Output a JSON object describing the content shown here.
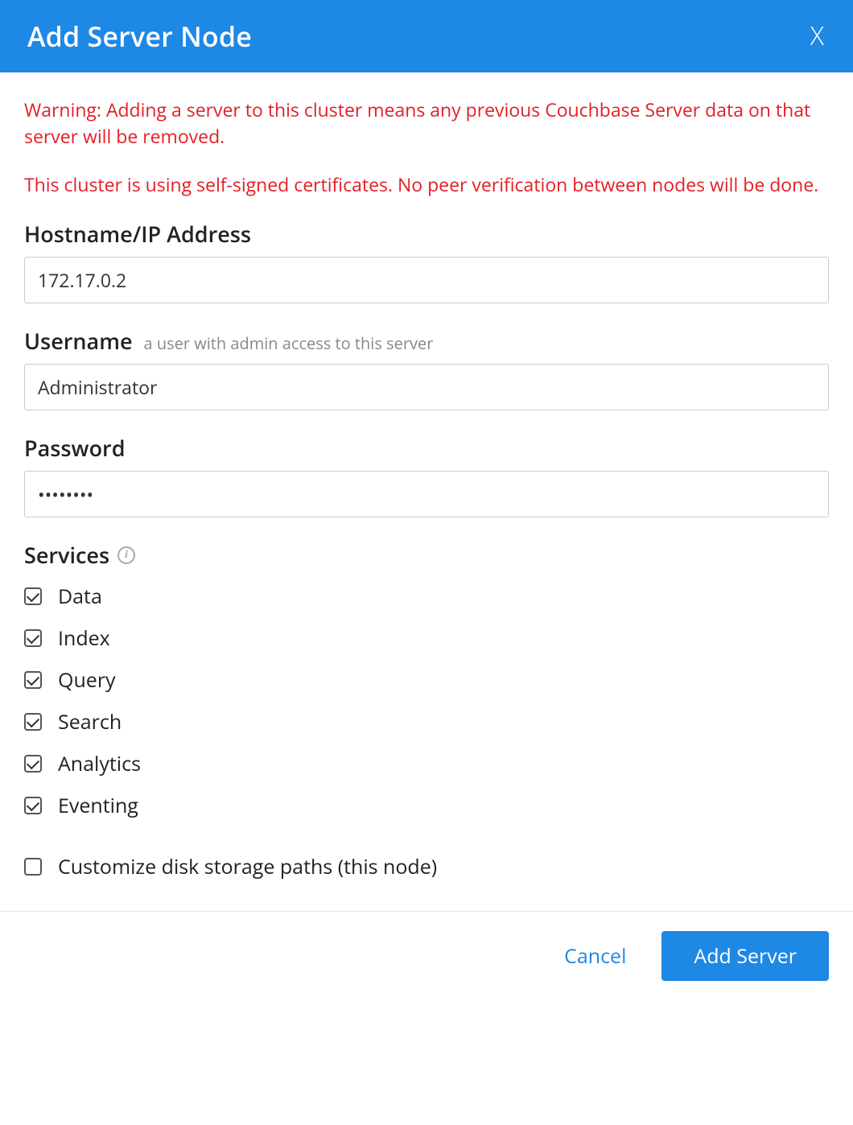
{
  "dialog": {
    "title": "Add Server Node",
    "close_symbol": "X"
  },
  "warnings": {
    "w1": "Warning: Adding a server to this cluster means any previous Couchbase Server data on that server will be removed.",
    "w2": "This cluster is using self-signed certificates. No peer verification between nodes will be done."
  },
  "fields": {
    "hostname": {
      "label": "Hostname/IP Address",
      "value": "172.17.0.2"
    },
    "username": {
      "label": "Username",
      "hint": "a user with admin access to this server",
      "value": "Administrator"
    },
    "password": {
      "label": "Password",
      "value": "••••••••"
    }
  },
  "services": {
    "label": "Services",
    "items": {
      "data": {
        "label": "Data",
        "checked": true
      },
      "index": {
        "label": "Index",
        "checked": true
      },
      "query": {
        "label": "Query",
        "checked": true
      },
      "search": {
        "label": "Search",
        "checked": true
      },
      "analytics": {
        "label": "Analytics",
        "checked": true
      },
      "eventing": {
        "label": "Eventing",
        "checked": true
      }
    }
  },
  "customize": {
    "label": "Customize disk storage paths (this node)",
    "checked": false
  },
  "buttons": {
    "cancel": "Cancel",
    "submit": "Add Server"
  }
}
